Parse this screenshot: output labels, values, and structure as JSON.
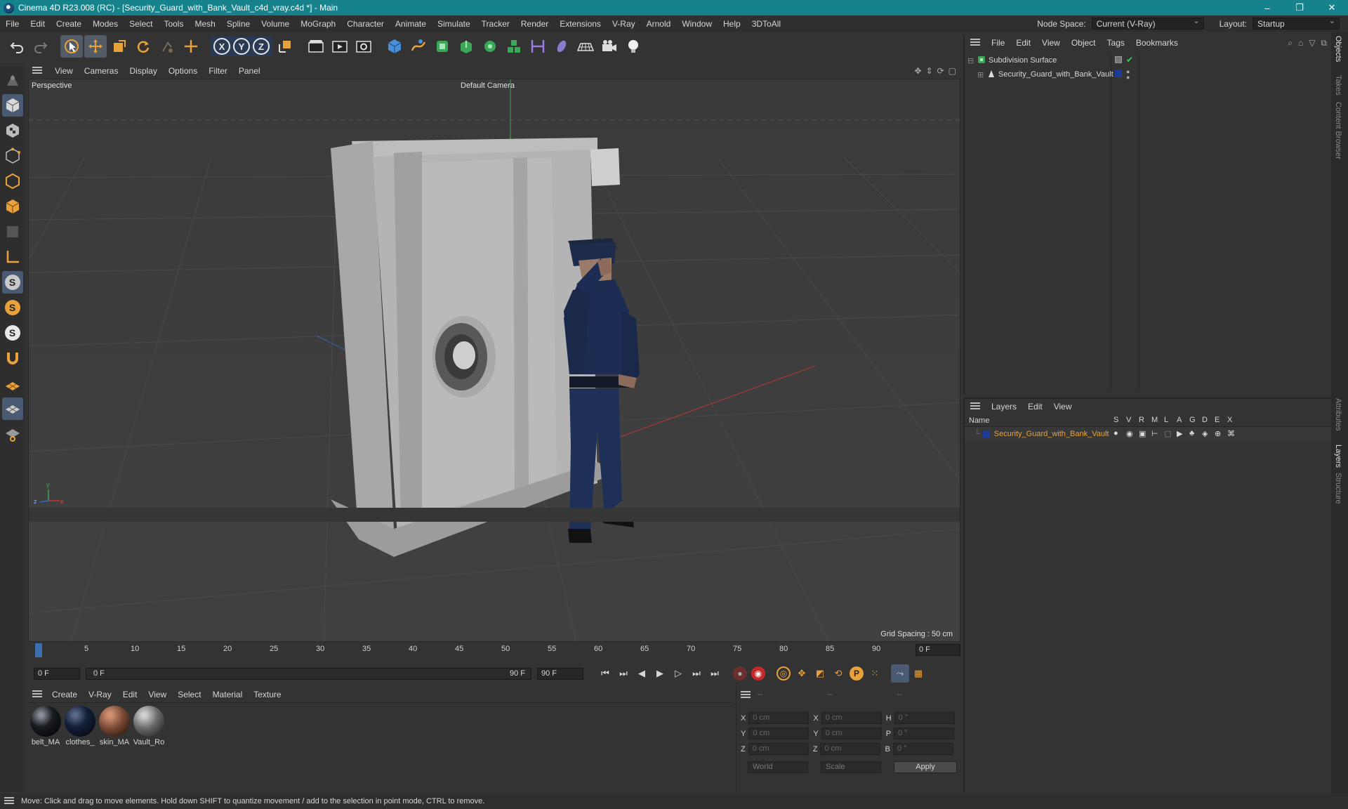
{
  "title_bar": {
    "title": "Cinema 4D R23.008 (RC) - [Security_Guard_with_Bank_Vault_c4d_vray.c4d *] - Main",
    "minimize": "–",
    "restore": "❐",
    "close": "✕"
  },
  "menubar": {
    "items": [
      "File",
      "Edit",
      "Create",
      "Modes",
      "Select",
      "Tools",
      "Mesh",
      "Spline",
      "Volume",
      "MoGraph",
      "Character",
      "Animate",
      "Simulate",
      "Tracker",
      "Render",
      "Extensions",
      "V-Ray",
      "Arnold",
      "Window",
      "Help",
      "3DToAll"
    ],
    "node_space_label": "Node Space:",
    "node_space_value": "Current (V-Ray)",
    "layout_label": "Layout:",
    "layout_value": "Startup"
  },
  "toolbar": {
    "axis_x": "X",
    "axis_y": "Y",
    "axis_z": "Z"
  },
  "viewport": {
    "menu": [
      "View",
      "Cameras",
      "Display",
      "Options",
      "Filter",
      "Panel"
    ],
    "label": "Perspective",
    "camera": "Default Camera",
    "grid_spacing": "Grid Spacing : 50 cm",
    "axis_y": "y",
    "axis_z": "z",
    "axis_x": "x"
  },
  "timeline": {
    "ticks": [
      "0",
      "5",
      "10",
      "15",
      "20",
      "25",
      "30",
      "35",
      "40",
      "45",
      "50",
      "55",
      "60",
      "65",
      "70",
      "75",
      "80",
      "85",
      "90"
    ],
    "current_frame": "0 F"
  },
  "transport": {
    "start_field": "0 F",
    "range_start": "0 F",
    "range_end": "90 F",
    "end_field": "90 F"
  },
  "materials": {
    "menu": [
      "Create",
      "V-Ray",
      "Edit",
      "View",
      "Select",
      "Material",
      "Texture"
    ],
    "items": [
      {
        "label": "belt_MA",
        "color": "#1a1c22"
      },
      {
        "label": "clothes_",
        "color": "#14203a"
      },
      {
        "label": "skin_MA",
        "color": "#7a4a35"
      },
      {
        "label": "Vault_Ro",
        "color": "#6a6a6a"
      }
    ]
  },
  "coords": {
    "hdr1": "--",
    "hdr2": "--",
    "hdr3": "--",
    "rows": [
      {
        "a": "X",
        "av": "0 cm",
        "b": "X",
        "bv": "0 cm",
        "c": "H",
        "cv": "0 °"
      },
      {
        "a": "Y",
        "av": "0 cm",
        "b": "Y",
        "bv": "0 cm",
        "c": "P",
        "cv": "0 °"
      },
      {
        "a": "Z",
        "av": "0 cm",
        "b": "Z",
        "bv": "0 cm",
        "c": "B",
        "cv": "0 °"
      }
    ],
    "world": "World",
    "scale": "Scale",
    "apply": "Apply"
  },
  "status": {
    "text": "Move: Click and drag to move elements. Hold down SHIFT to quantize movement / add to the selection in point mode, CTRL to remove."
  },
  "objects": {
    "menu": [
      "File",
      "Edit",
      "View",
      "Object",
      "Tags",
      "Bookmarks"
    ],
    "rows": [
      {
        "name": "Subdivision Surface"
      },
      {
        "name": "Security_Guard_with_Bank_Vault"
      }
    ]
  },
  "layers": {
    "menu": [
      "Layers",
      "Edit",
      "View"
    ],
    "col_name": "Name",
    "flags": [
      "S",
      "V",
      "R",
      "M",
      "L",
      "A",
      "G",
      "D",
      "E",
      "X"
    ],
    "row_name": "Security_Guard_with_Bank_Vault",
    "row_color": "#1e3a9a"
  },
  "side_tabs": [
    "Objects",
    "Takes",
    "Content Browser",
    "Attributes",
    "Layers",
    "Structure"
  ]
}
